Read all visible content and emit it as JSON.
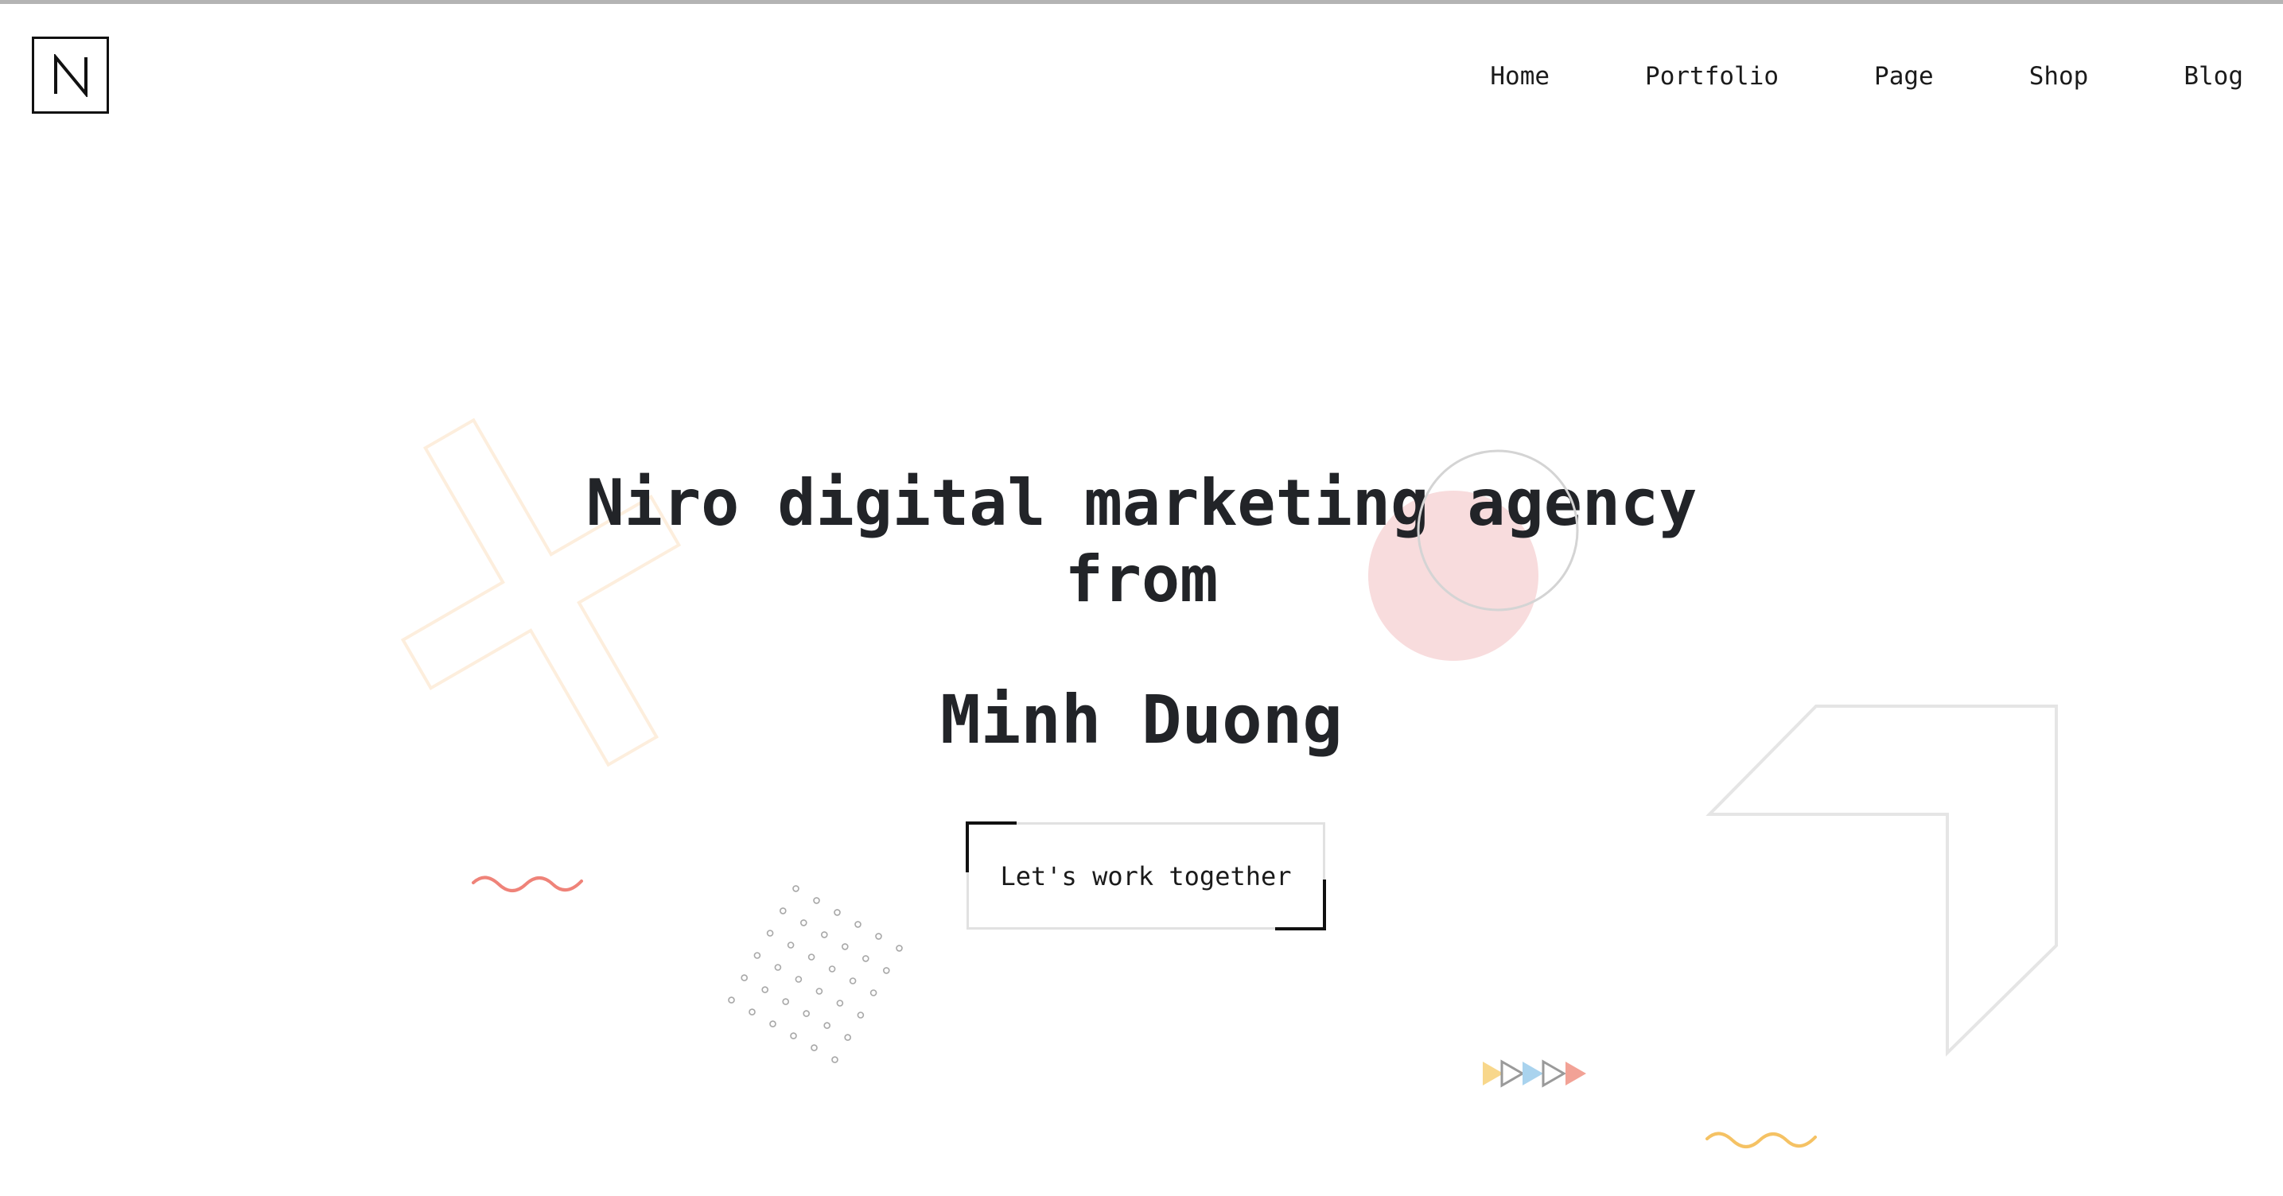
{
  "header": {
    "logo_letter": "N",
    "nav": [
      {
        "label": "Home"
      },
      {
        "label": "Portfolio"
      },
      {
        "label": "Page"
      },
      {
        "label": "Shop"
      },
      {
        "label": "Blog"
      }
    ]
  },
  "hero": {
    "title_line1": "Niro digital marketing agency",
    "title_line2": "from",
    "name": "Minh Duong",
    "cta_label": "Let's work together"
  },
  "colors": {
    "text": "#222428",
    "pink_circle": "#f8dcdd",
    "cross_outline": "#fdeedd",
    "wave_red": "#ef8379",
    "wave_yellow": "#f5c264",
    "triangle_yellow": "#f8d78b",
    "triangle_blue": "#a9d3ee",
    "triangle_red": "#f2a296",
    "gray_outline": "#e5e5e5"
  }
}
